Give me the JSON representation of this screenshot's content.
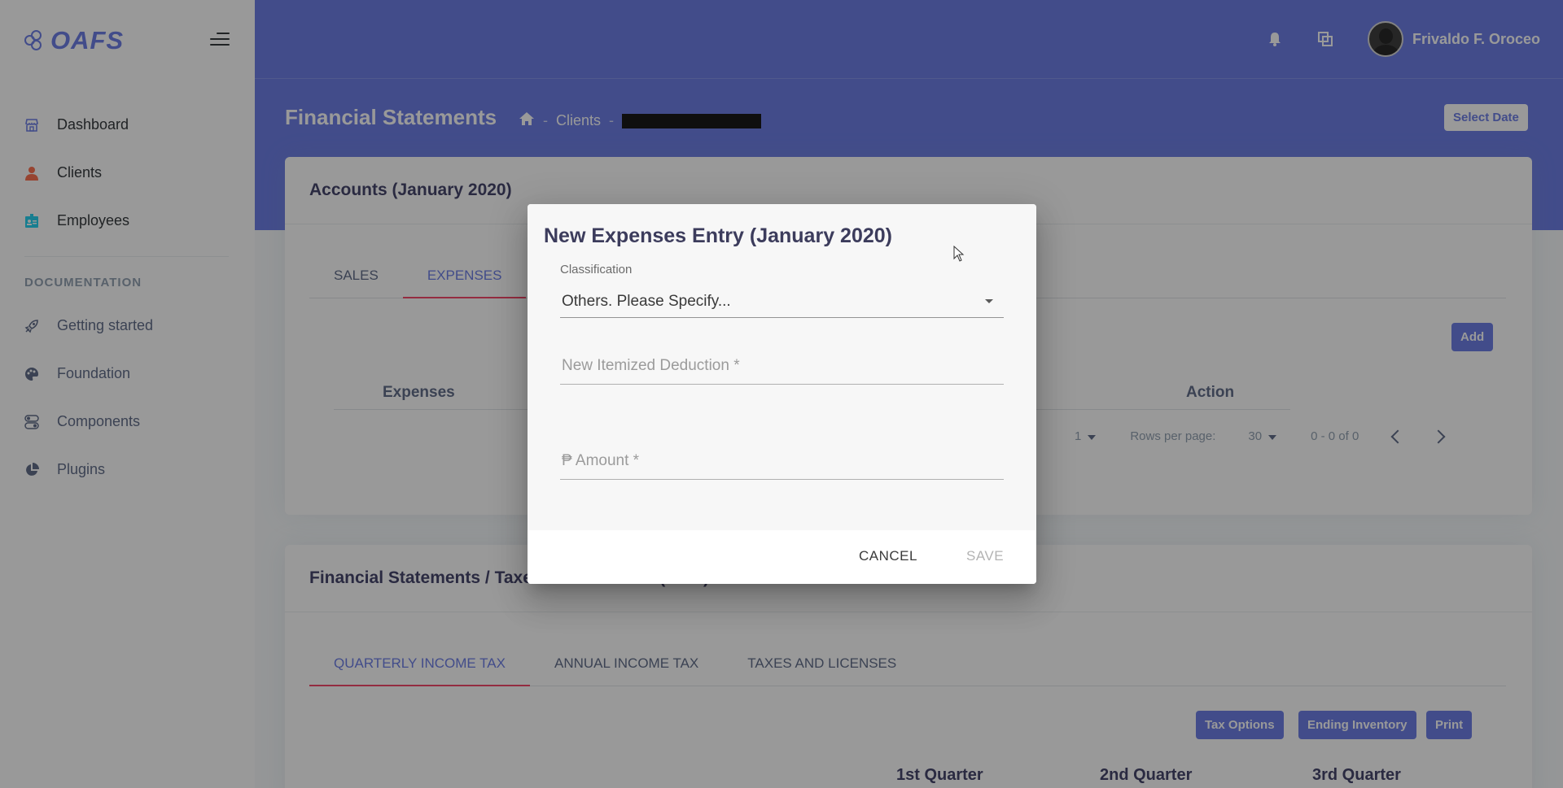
{
  "sidebar": {
    "logo_text": "OAFS",
    "nav_items": [
      {
        "label": "Dashboard",
        "icon": "shop-icon",
        "color": "#5e72e4"
      },
      {
        "label": "Clients",
        "icon": "person-icon",
        "color": "#fb6340"
      },
      {
        "label": "Employees",
        "icon": "id-badge-icon",
        "color": "#11cdef"
      }
    ],
    "section_heading": "DOCUMENTATION",
    "doc_items": [
      {
        "label": "Getting started",
        "icon": "spaceship-icon"
      },
      {
        "label": "Foundation",
        "icon": "palette-icon"
      },
      {
        "label": "Components",
        "icon": "ui-components-icon"
      },
      {
        "label": "Plugins",
        "icon": "chart-pie-icon"
      }
    ]
  },
  "header": {
    "username": "Frivaldo F. Oroceo",
    "page_title": "Financial Statements",
    "breadcrumb": [
      "home",
      "Clients"
    ],
    "select_date": "Select Date"
  },
  "accounts_card": {
    "title": "Accounts (January 2020)",
    "tabs": [
      "SALES",
      "EXPENSES"
    ],
    "active_tab": "EXPENSES",
    "add_button": "Add",
    "columns": [
      "Expenses",
      "Action"
    ],
    "pagination": {
      "page": "1",
      "rows_label": "Rows per page:",
      "rows_value": "30",
      "range": "0 - 0 of 0"
    }
  },
  "statements_card": {
    "title": "Financial Statements / Taxes and Licenses (2020)",
    "tabs": [
      "QUARTERLY INCOME TAX",
      "ANNUAL INCOME TAX",
      "TAXES AND LICENSES"
    ],
    "active_tab": "QUARTERLY INCOME TAX",
    "buttons": [
      "Tax Options",
      "Ending Inventory",
      "Print"
    ],
    "columns": [
      "1st Quarter",
      "2nd Quarter",
      "3rd Quarter"
    ]
  },
  "dialog": {
    "title": "New Expenses Entry (January 2020)",
    "classification_label": "Classification",
    "classification_value": "Others. Please Specify...",
    "deduction_placeholder": "New Itemized Deduction *",
    "amount_placeholder": "₱ Amount *",
    "cancel_label": "CANCEL",
    "save_label": "SAVE"
  },
  "colors": {
    "primary": "#5e72e4",
    "tab_indicator": "#f5365c",
    "overlay": "rgba(33,33,33,0.46)"
  }
}
